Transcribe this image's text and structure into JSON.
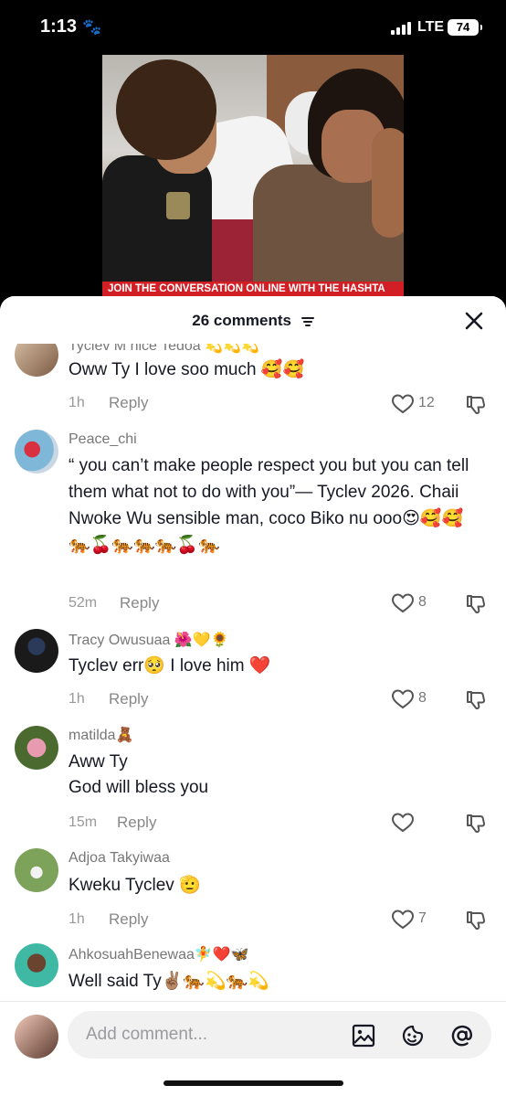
{
  "status_bar": {
    "time": "1:13",
    "network": "LTE",
    "battery": "74"
  },
  "video": {
    "banner_text": "JOIN THE CONVERSATION ONLINE WITH THE HASHTA"
  },
  "sheet": {
    "title": "26 comments"
  },
  "comments": [
    {
      "username": "Tyclev M  nice Tedoa 💫💫💫",
      "text": "Oww Ty I love soo much 🥰🥰",
      "time": "1h",
      "reply": "Reply",
      "likes": "12"
    },
    {
      "username": "Peace_chi",
      "text": "“ you can’t make people respect you but you can tell them what not to do with you”— Tyclev 2026. Chaii Nwoke Wu sensible man, coco Biko nu ooo😍🥰🥰🐅🍒🐅🐅🐅🍒🐅",
      "time": "52m",
      "reply": "Reply",
      "likes": "8"
    },
    {
      "username": "Tracy Owusuaa 🌺💛🌻",
      "text": "Tyclev err🥺 I love him ❤️",
      "time": "1h",
      "reply": "Reply",
      "likes": "8"
    },
    {
      "username": "matilda🧸",
      "text_line1": "Aww Ty",
      "text_line2": "God will bless you",
      "time": "15m",
      "reply": "Reply",
      "likes": ""
    },
    {
      "username": "Adjoa Takyiwaa",
      "text": "Kweku Tyclev 🫡",
      "time": "1h",
      "reply": "Reply",
      "likes": "7"
    },
    {
      "username": "AhkosuahBenewaa🧚❤️🦋",
      "text": "Well said Ty✌🏽🐅💫🐅💫"
    }
  ],
  "input": {
    "placeholder": "Add comment..."
  },
  "icons": {
    "image": "image-icon",
    "emoji": "emoji-icon",
    "mention": "at-icon",
    "like": "heart-outline-icon",
    "dislike": "thumbs-down-icon",
    "close": "close-icon",
    "sort": "sort-icon"
  }
}
